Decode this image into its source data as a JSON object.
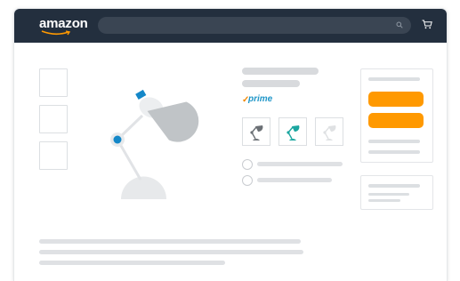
{
  "header": {
    "logo_text": "amazon",
    "search_icon": "search-icon",
    "cart_icon": "cart-icon"
  },
  "product": {
    "badge_text": "prime",
    "badge_check": "✓",
    "image_icon": "desk-lamp-illustration",
    "variant_icons": [
      "lamp-variant-dark-icon",
      "lamp-variant-teal-icon",
      "lamp-variant-light-icon"
    ]
  },
  "colors": {
    "header_bg": "#232f3e",
    "search_bg": "#3a4553",
    "buy_button": "#ff9900",
    "prime_blue": "#1f96c8",
    "prime_check": "#f08804",
    "lamp_accent": "#1487c8",
    "variant_teal": "#1ba6a0",
    "placeholder": "#d8dadd"
  }
}
